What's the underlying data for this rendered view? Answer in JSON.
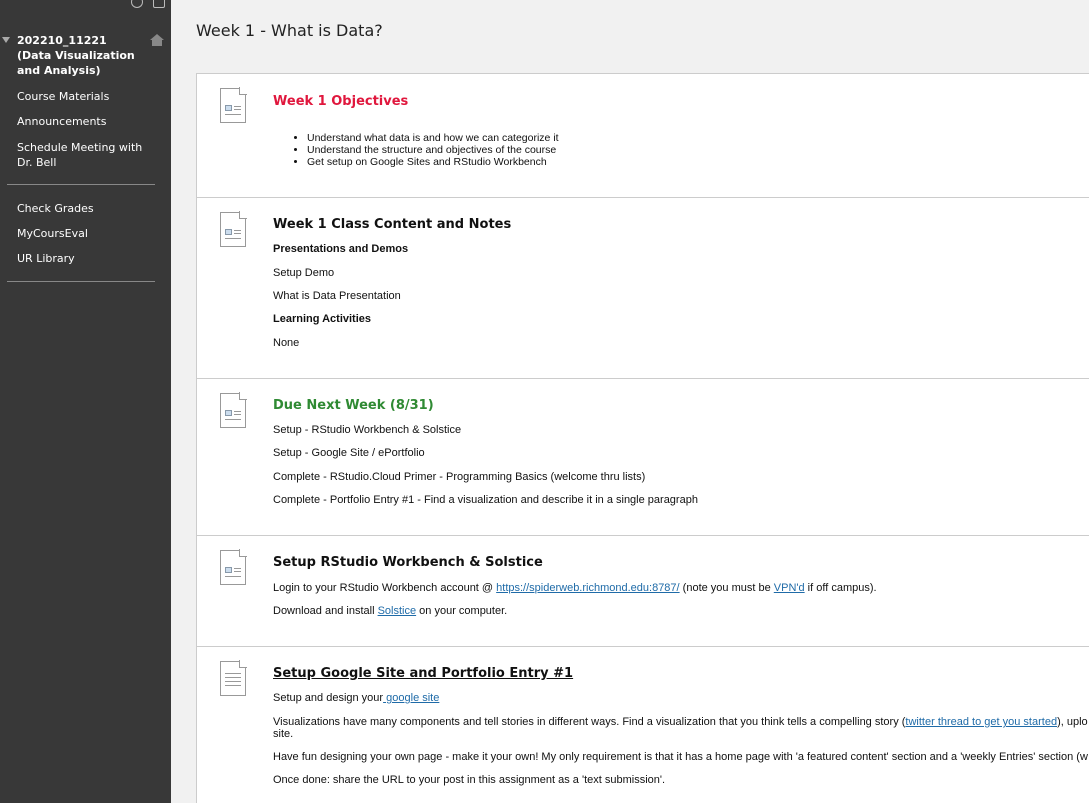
{
  "sidebar": {
    "course_title": "202210_11221 (Data Visualization and Analysis)",
    "items_primary": [
      "Course Materials",
      "Announcements",
      "Schedule Meeting with Dr. Bell"
    ],
    "items_secondary": [
      "Check Grades",
      "MyCoursEval",
      "UR Library"
    ]
  },
  "page": {
    "title": "Week 1 - What is Data?"
  },
  "items": {
    "objectives": {
      "title": "Week 1 Objectives",
      "bullets": [
        "Understand what data is and how we can categorize it",
        "Understand the structure and objectives of the course",
        "Get setup on Google Sites and RStudio Workbench"
      ]
    },
    "content": {
      "title": "Week 1 Class Content and Notes",
      "section1": "Presentations and Demos",
      "line1": "Setup Demo",
      "line2": "What is Data Presentation",
      "section2": "Learning Activities",
      "line3": "None"
    },
    "due": {
      "title": "Due Next Week (8/31)",
      "lines": [
        "Setup - RStudio Workbench & Solstice",
        "Setup - Google Site / ePortfolio",
        "Complete - RStudio.Cloud Primer - Programming Basics (welcome thru lists)",
        "Complete - Portfolio Entry #1 - Find a visualization and describe it in a single paragraph"
      ]
    },
    "rstudio": {
      "title": "Setup RStudio Workbench & Solstice",
      "l1_a": "Login to your RStudio Workbench account @ ",
      "l1_link": "https://spiderweb.richmond.edu:8787/",
      "l1_b": " (note you must be ",
      "l1_link2": "VPN'd",
      "l1_c": " if off campus).",
      "l2_a": "Download and install ",
      "l2_link": "Solstice",
      "l2_b": " on your computer."
    },
    "google": {
      "title": "Setup Google Site and Portfolio Entry #1",
      "l1_a": "Setup and design your",
      "l1_link": " google site",
      "l2_a": "Visualizations have many components and tell stories in different ways. Find a visualization that you think tells a compelling story (",
      "l2_link": "twitter thread to get you started",
      "l2_b": "), uplo",
      "l2_c": "site.",
      "l3": "Have fun designing your own page - make it your own! My only requirement is that it has a home page with 'a featured content' section and a 'weekly Entries' section (w",
      "l4": "Once done: share the URL to your post in this assignment as a 'text submission'."
    }
  }
}
